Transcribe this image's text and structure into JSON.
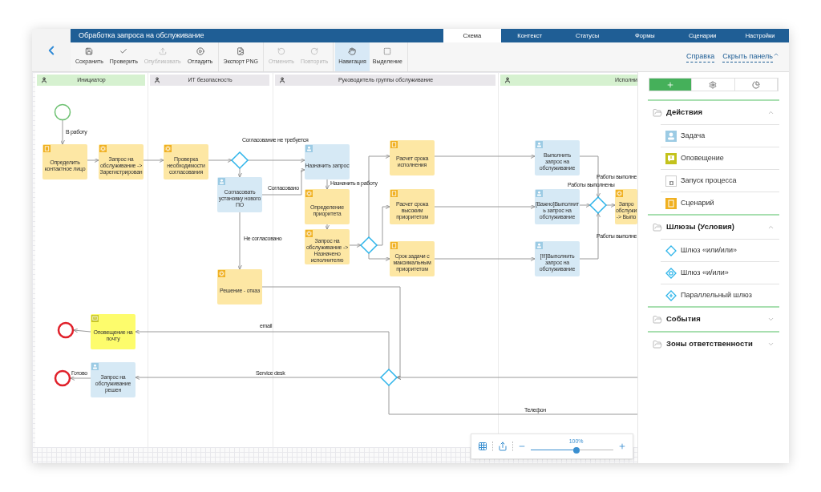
{
  "window": {
    "title": "Обработка запроса на обслуживание"
  },
  "tabs": [
    {
      "label": "Схема",
      "selected": true
    },
    {
      "label": "Контекст",
      "selected": false
    },
    {
      "label": "Статусы",
      "selected": false
    },
    {
      "label": "Формы",
      "selected": false
    },
    {
      "label": "Сценарии",
      "selected": false
    },
    {
      "label": "Настройки",
      "selected": false
    }
  ],
  "toolbar": [
    [
      {
        "kind": "save",
        "label": "Сохранить",
        "disabled": false,
        "selected": false
      },
      {
        "kind": "check",
        "label": "Проверить",
        "disabled": false,
        "selected": false
      },
      {
        "kind": "publish",
        "label": "Опубликовать",
        "disabled": true,
        "selected": false
      },
      {
        "kind": "debug",
        "label": "Отладить",
        "disabled": false,
        "selected": false
      }
    ],
    [
      {
        "kind": "export",
        "label": "Экспорт PNG",
        "disabled": false,
        "selected": false
      }
    ],
    [
      {
        "kind": "undo",
        "label": "Отменить",
        "disabled": true,
        "selected": false
      },
      {
        "kind": "redo",
        "label": "Повторить",
        "disabled": true,
        "selected": false
      }
    ],
    [
      {
        "kind": "hand",
        "label": "Навигация",
        "disabled": false,
        "selected": true
      },
      {
        "kind": "select",
        "label": "Выделение",
        "disabled": false,
        "selected": false
      }
    ]
  ],
  "links": [
    "Справка",
    "Скрыть панель"
  ],
  "lanes": [
    {
      "title": "Инициатор",
      "color": "#d6f1d0"
    },
    {
      "title": "ИТ безопасность",
      "color": "#e9e7eb"
    },
    {
      "title": "Руководитель группы обслуживание",
      "color": "#e9e7eb"
    },
    {
      "title": "Исполни",
      "color": "#d6f1d0"
    }
  ],
  "nodes": [
    {
      "kind": "start"
    },
    {
      "kind": "script",
      "text": "Определить контактное лицо"
    },
    {
      "kind": "service",
      "text": "Запрос на обслуживание -> Зарегистрирован"
    },
    {
      "kind": "service",
      "text": "Проверка необходимости согласования"
    },
    {
      "kind": "gateway"
    },
    {
      "kind": "user",
      "text": "Согласовать установку нового ПО"
    },
    {
      "kind": "service",
      "text": "Решение - отказ"
    },
    {
      "kind": "user",
      "text": "Назначить запрос"
    },
    {
      "kind": "service",
      "text": "Определение приоритета"
    },
    {
      "kind": "service",
      "text": "Запрос на обслуживание -> Назначено исполнителю"
    },
    {
      "kind": "gateway"
    },
    {
      "kind": "script",
      "text": "Расчет срока исполнения"
    },
    {
      "kind": "script",
      "text": "Расчет срока высоким приоритетом"
    },
    {
      "kind": "script",
      "text": "Срок задачи с максимальным приоритетом"
    },
    {
      "kind": "user",
      "text": "Выполнить запрос на обслуживание"
    },
    {
      "kind": "user",
      "text": "[Важно]Выполнить запрос на обслуживание"
    },
    {
      "kind": "user",
      "text": "[!!!]Выполнить запрос на обслуживание"
    },
    {
      "kind": "gateway"
    },
    {
      "kind": "service",
      "text": "Запро обслужи -> Выпо"
    },
    {
      "kind": "notification",
      "text": "Оповещение на почту"
    },
    {
      "kind": "end"
    },
    {
      "kind": "user",
      "text": "Запрос на обслуживание решен"
    },
    {
      "kind": "end"
    },
    {
      "kind": "gateway"
    }
  ],
  "edge_labels": [
    "В работу",
    "Согласование не требуется",
    "Согласовано",
    "Не согласовано",
    "Назначить в работу",
    "Работы выполне",
    "Работы выполнены",
    "Работы выполне",
    "email",
    "Service desk",
    "Готово",
    "Телефон"
  ],
  "zoom": {
    "label": "100%",
    "level": 0.55
  },
  "panel": {
    "tabs": [
      {
        "kind": "elements",
        "selected": true
      },
      {
        "kind": "settings",
        "selected": false
      },
      {
        "kind": "chart",
        "selected": false
      }
    ],
    "sections": [
      {
        "title": "Действия",
        "expanded": true,
        "items": [
          {
            "kind": "task",
            "label": "Задача"
          },
          {
            "kind": "notification",
            "label": "Оповещение"
          },
          {
            "kind": "process",
            "label": "Запуск процесса"
          },
          {
            "kind": "script",
            "label": "Сценарий"
          }
        ]
      },
      {
        "title": "Шлюзы (Условия)",
        "expanded": true,
        "items": [
          {
            "kind": "xor",
            "label": "Шлюз «или/или»"
          },
          {
            "kind": "or",
            "label": "Шлюз «и/или»"
          },
          {
            "kind": "parallel",
            "label": "Параллельный шлюз"
          }
        ]
      },
      {
        "title": "События",
        "expanded": false
      },
      {
        "title": "Зоны ответственности",
        "expanded": false
      }
    ]
  }
}
